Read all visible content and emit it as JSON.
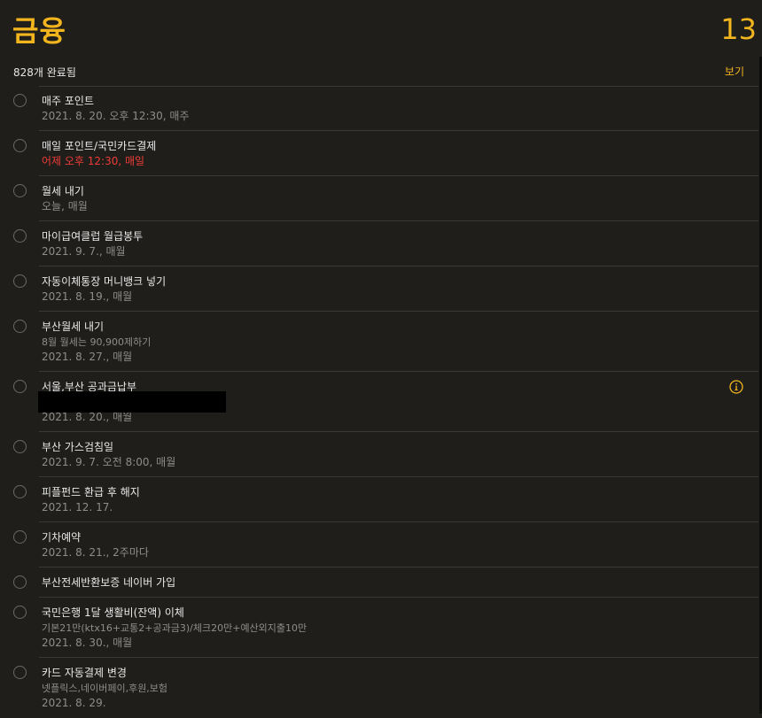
{
  "header": {
    "title": "금융",
    "count": "13"
  },
  "completed": {
    "text": "828개 완료됨",
    "show_label": "보기"
  },
  "items": [
    {
      "title": "매주 포인트",
      "date": "2021. 8. 20. 오후 12:30, 매주"
    },
    {
      "title": "매일 포인트/국민카드결제",
      "date": "어제 오후 12:30, 매일",
      "overdue": true
    },
    {
      "title": "월세 내기",
      "date": "오늘, 매월"
    },
    {
      "title": "마이급여클럽 월급봉투",
      "date": "2021. 9. 7., 매월"
    },
    {
      "title": "자동이체통장 머니뱅크 넣기",
      "date": "2021. 8. 19., 매월"
    },
    {
      "title": "부산월세 내기",
      "note": "8월 월세는 90,900제하기",
      "date": "2021. 8. 27., 매월"
    },
    {
      "title": "서울,부산 공과금납부",
      "date": "2021. 8. 20., 매월"
    },
    {
      "title": "부산 가스검침일",
      "date": "2021. 9. 7. 오전 8:00, 매월"
    },
    {
      "title": "피플펀드 환급 후 해지",
      "date": "2021. 12. 17."
    },
    {
      "title": "기차예약",
      "date": "2021. 8. 21., 2주마다"
    },
    {
      "title": "부산전세반환보증 네이버 가입"
    },
    {
      "title": "국민은행 1달 생활비(잔액) 이체",
      "note": "기본21만(ktx16+교통2+공과금3)/체크20만+예산외지출10만",
      "date": "2021. 8. 30., 매월"
    },
    {
      "title": "카드 자동결제 변경",
      "note": "넷플릭스,네이버페이,후원,보험",
      "date": "2021. 8. 29."
    }
  ],
  "colors": {
    "accent": "#f2b51e",
    "overdue": "#ef3b36",
    "background": "#1f1e1b"
  },
  "icons": {
    "info": "info-icon",
    "checkbox": "circle-checkbox-icon"
  }
}
